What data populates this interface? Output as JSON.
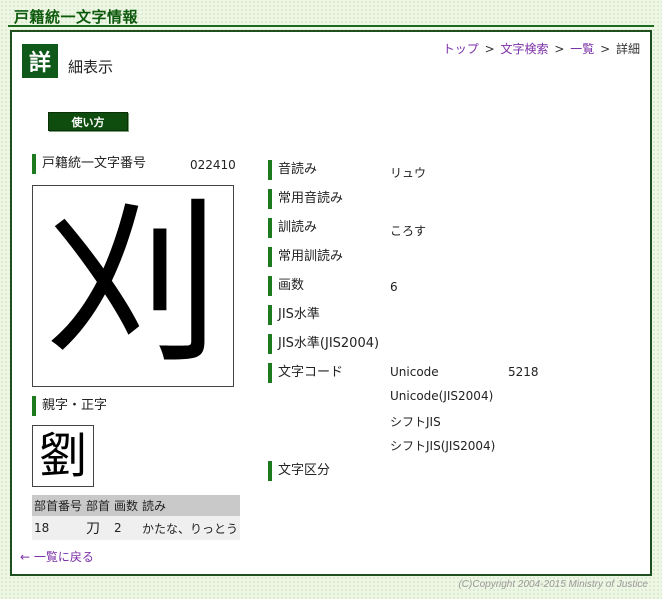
{
  "site": {
    "title": "戸籍統一文字情報"
  },
  "header": {
    "badge": "詳",
    "heading": "細表示",
    "breadcrumb": {
      "top": "トップ",
      "search": "文字検索",
      "list": "一覧",
      "current": "詳細",
      "sep": ">"
    }
  },
  "usage_button": "使い方",
  "character": {
    "number_label": "戸籍統一文字番号",
    "number_value": "022410",
    "glyph": "刈",
    "parent_label": "親字・正字",
    "parent_glyph": "劉"
  },
  "radical_table": {
    "headers": [
      "部首番号",
      "部首",
      "画数",
      "読み"
    ],
    "row": {
      "radical_no": "18",
      "radical": "刀",
      "strokes": "2",
      "reading": "かたな、りっとう"
    }
  },
  "fields": {
    "on_yomi": {
      "label": "音読み",
      "value": "リュウ"
    },
    "joyo_on": {
      "label": "常用音読み",
      "value": ""
    },
    "kun_yomi": {
      "label": "訓読み",
      "value": "ころす"
    },
    "joyo_kun": {
      "label": "常用訓読み",
      "value": ""
    },
    "stroke_count": {
      "label": "画数",
      "value": "6"
    },
    "jis_level": {
      "label": "JIS水準",
      "value": ""
    },
    "jis_level_2004": {
      "label": "JIS水準(JIS2004)",
      "value": ""
    },
    "char_code": {
      "label": "文字コード",
      "unicode_label": "Unicode",
      "unicode_value": "5218",
      "unicode2004_label": "Unicode(JIS2004)",
      "sjis_label": "シフトJIS",
      "sjis2004_label": "シフトJIS(JIS2004)"
    },
    "char_class": {
      "label": "文字区分",
      "value": ""
    }
  },
  "back_link": "← 一覧に戻る",
  "copyright": "(C)Copyright 2004-2015 Ministry of Justice"
}
